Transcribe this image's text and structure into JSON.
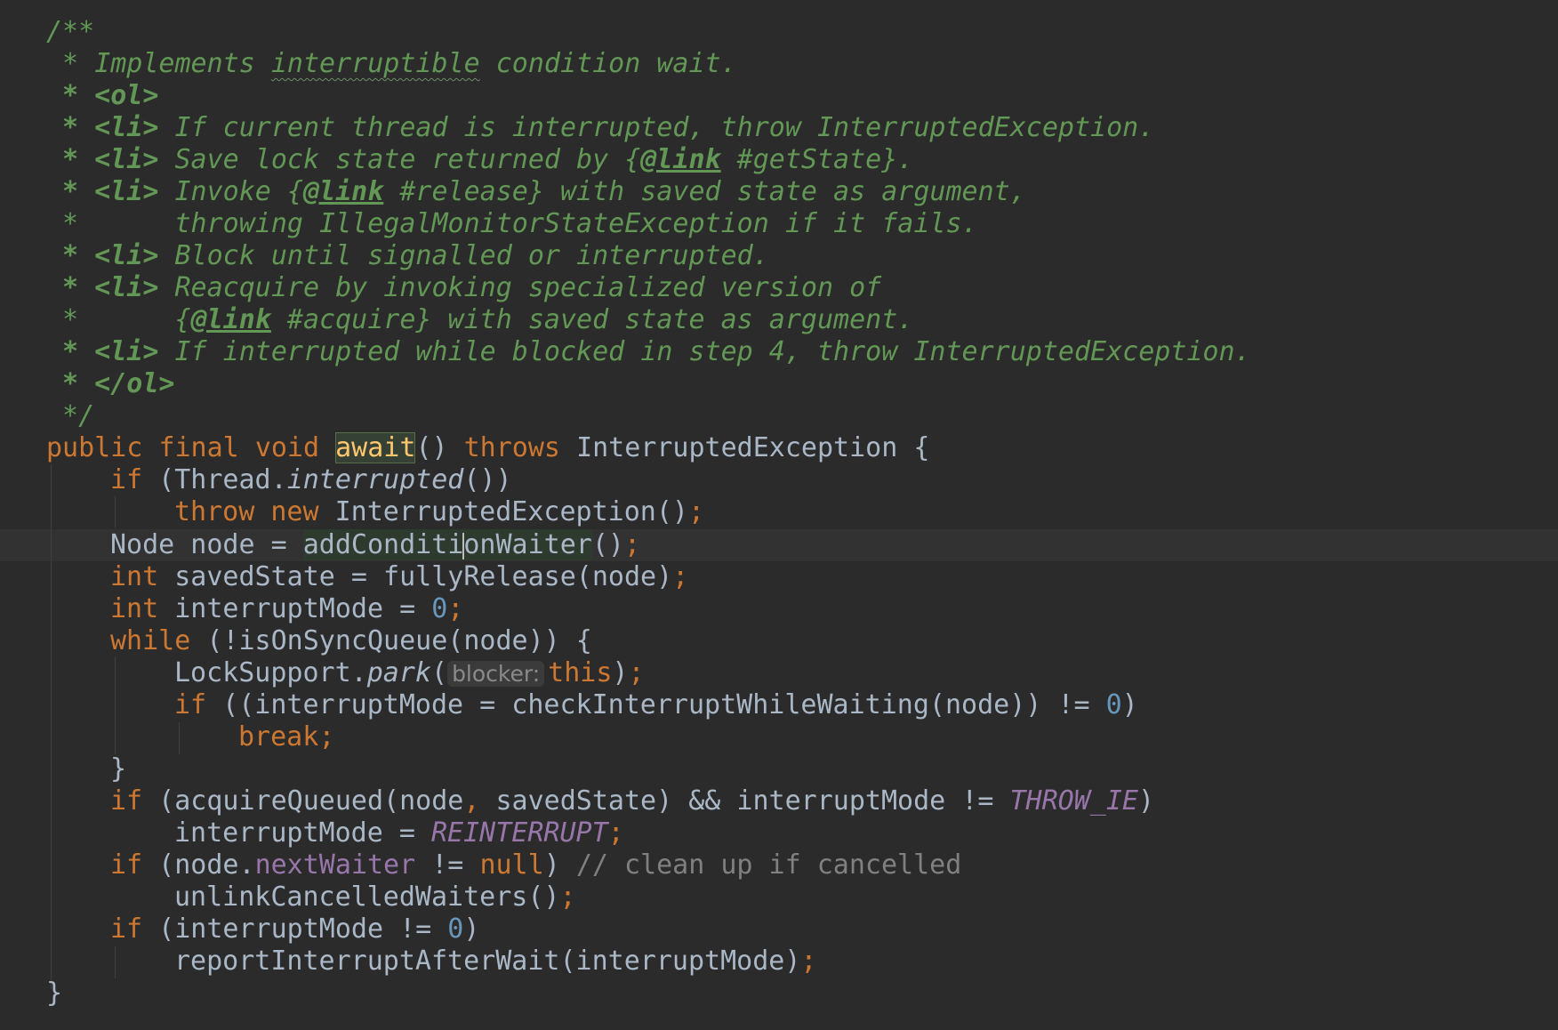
{
  "editor": {
    "language": "Java",
    "theme_colors": {
      "background": "#2b2b2b",
      "caret_row": "#323232",
      "comment": "#629755",
      "keyword": "#cc7832",
      "plain": "#a9b7c6",
      "number": "#6897bb",
      "constant": "#9876aa",
      "method_declaration": "#ffc66d",
      "line_comment": "#808080",
      "inlay_hint": "#8a8a8a"
    },
    "doc_comment": {
      "open": "/**",
      "line1_prefix": " * ",
      "line1_text_a": "Implements ",
      "line1_word_underlined": "interruptible",
      "line1_text_b": " condition wait.",
      "line2": " * <ol>",
      "line3_prefix": " * <li>",
      "line3_text": " If current thread is interrupted, throw InterruptedException.",
      "line4_prefix": " * <li>",
      "line4_text_a": " Save lock state returned by {",
      "line4_tag": "@link",
      "line4_text_b": " #getState}.",
      "line5_prefix": " * <li>",
      "line5_text_a": " Invoke {",
      "line5_tag": "@link",
      "line5_text_b": " #release} with saved state as argument,",
      "line6": " *      throwing IllegalMonitorStateException if it fails.",
      "line7_prefix": " * <li>",
      "line7_text": " Block until signalled or interrupted.",
      "line8_prefix": " * <li>",
      "line8_text": " Reacquire by invoking specialized version of",
      "line9_prefix": " *      {",
      "line9_tag": "@link",
      "line9_text": " #acquire} with saved state as argument.",
      "line10_prefix": " * <li>",
      "line10_text": " If interrupted while blocked in step 4, throw InterruptedException.",
      "line11": " * </ol>",
      "close": " */"
    },
    "code": {
      "decl_public": "public",
      "decl_final": "final",
      "decl_void": "void",
      "method_name": "await",
      "decl_parens": "()",
      "decl_throws": "throws",
      "decl_exception": "InterruptedException {",
      "if_kw": "if",
      "l2_a": " (Thread.",
      "l2_static": "interrupted",
      "l2_b": "())",
      "throw_kw": "throw",
      "new_kw": "new",
      "l3_text": " InterruptedException()",
      "semicolon": ";",
      "l4_a": "Node node = ",
      "l4_call_a": "addConditi",
      "l4_call_b": "onWaiter",
      "l4_b": "()",
      "int_kw": "int",
      "l5_text": " savedState = fullyRelease(node)",
      "l6_text": " interruptMode = ",
      "zero": "0",
      "while_kw": "while",
      "l7_text": " (!isOnSyncQueue(node)) {",
      "l8_a": "LockSupport.",
      "l8_static": "park",
      "l8_b": "(",
      "l8_hint": "blocker:",
      "this_kw": "this",
      "l8_c": ")",
      "l9_text": " ((interruptMode = checkInterruptWhileWaiting(node)) != ",
      "l9_close": ")",
      "break_kw": "break",
      "close_brace": "}",
      "l12_a": " (acquireQueued(node",
      "comma": ",",
      "l12_b": " savedState) && interruptMode != ",
      "throw_ie": "THROW_IE",
      "l12_close": ")",
      "l13_text": "interruptMode = ",
      "reinterrupt": "REINTERRUPT",
      "l14_a": " (node.",
      "next_waiter": "nextWaiter",
      "l14_b": " != ",
      "null_kw": "null",
      "l14_c": ") ",
      "l14_comment": "// clean up if cancelled",
      "l15_text": "unlinkCancelledWaiters()",
      "l16_text": " (interruptMode != ",
      "l17_text": "reportInterruptAfterWait(interruptMode)",
      "final_brace": "}"
    }
  }
}
